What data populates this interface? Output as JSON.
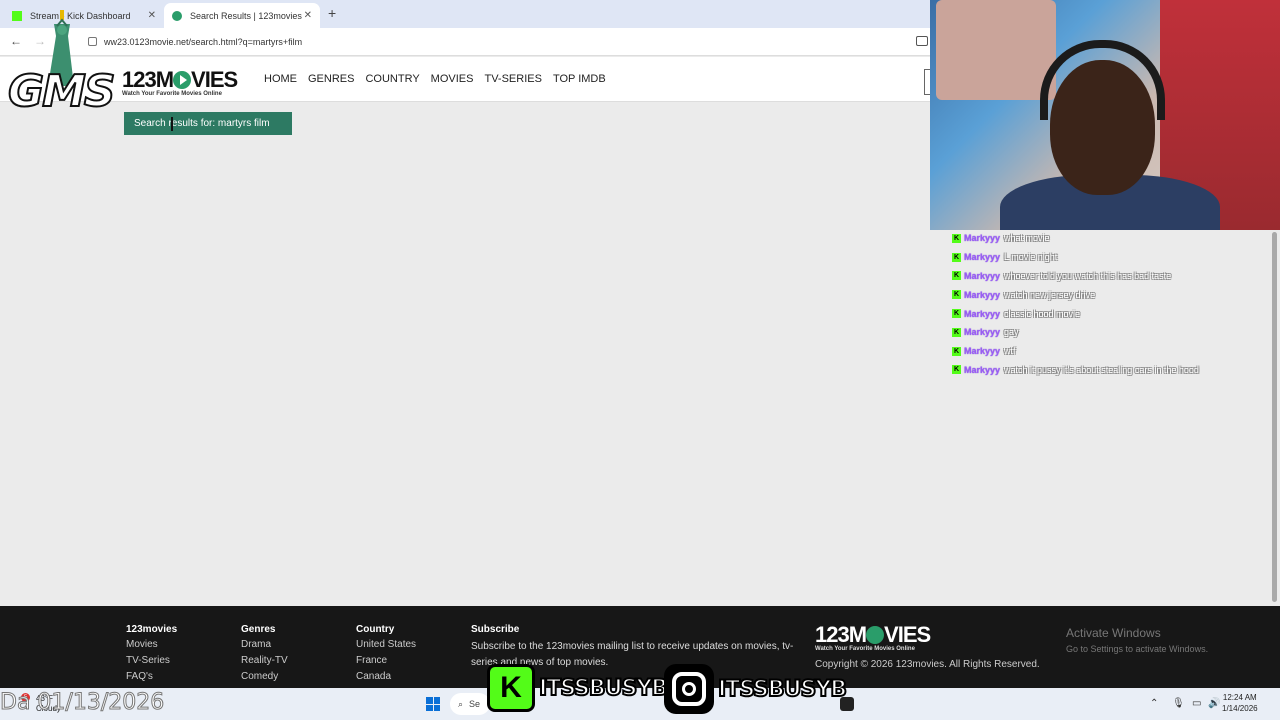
{
  "browser": {
    "tabs": [
      {
        "label": "Stream - Kick Dashboard",
        "icon": "kick-icon"
      },
      {
        "label": "Search Results | 123movies",
        "icon": "play-icon"
      }
    ],
    "new_tab": "+",
    "url": "ww23.0123movie.net/search.html?q=martyrs+film"
  },
  "site": {
    "logo_text": "123M",
    "logo_text_end": "VIES",
    "logo_tagline": "Watch Your Favorite Movies Online",
    "nav": [
      "HOME",
      "GENRES",
      "COUNTRY",
      "MOVIES",
      "TV-SERIES",
      "TOP IMDB"
    ],
    "search_banner": "Search results for: martyrs film"
  },
  "overlay": {
    "gms": "GMS",
    "date": "Da 01/13/2026"
  },
  "chat": {
    "username": "Markyyy",
    "messages": [
      "what movie",
      "L movie night",
      "whoever told you watch this has bad taste",
      "watch new jersey drive",
      "classic hood movie",
      "gay",
      "wtf",
      "watch it pussy it's about stealing cars in the hood"
    ]
  },
  "footer": {
    "col1": {
      "heading": "123movies",
      "items": [
        "Movies",
        "TV-Series",
        "FAQ's"
      ]
    },
    "col2": {
      "heading": "Genres",
      "items": [
        "Drama",
        "Reality-TV",
        "Comedy"
      ]
    },
    "col3": {
      "heading": "Country",
      "items": [
        "United States",
        "France",
        "Canada"
      ]
    },
    "subscribe": {
      "heading": "Subscribe",
      "text": "Subscribe to the 123movies mailing list to receive updates on movies, tv-series and news of top movies."
    },
    "copyright": "Copyright © 2026 123movies. All Rights Reserved.",
    "activate_title": "Activate Windows",
    "activate_sub": "Go to Settings to activate Windows."
  },
  "taskbar": {
    "weather_temp": "43°F",
    "weather_desc": "Cloudy",
    "notif_count": "5",
    "search_label": "Se",
    "social_handle_kick": "ITSSBUSYB",
    "social_handle_ig": "ITSSBUSYB",
    "time": "12:24 AM",
    "date": "1/14/2026"
  },
  "colors": {
    "accent_green": "#2d7a63",
    "kick_green": "#53fc18",
    "chat_username": "#9b5cf6"
  }
}
